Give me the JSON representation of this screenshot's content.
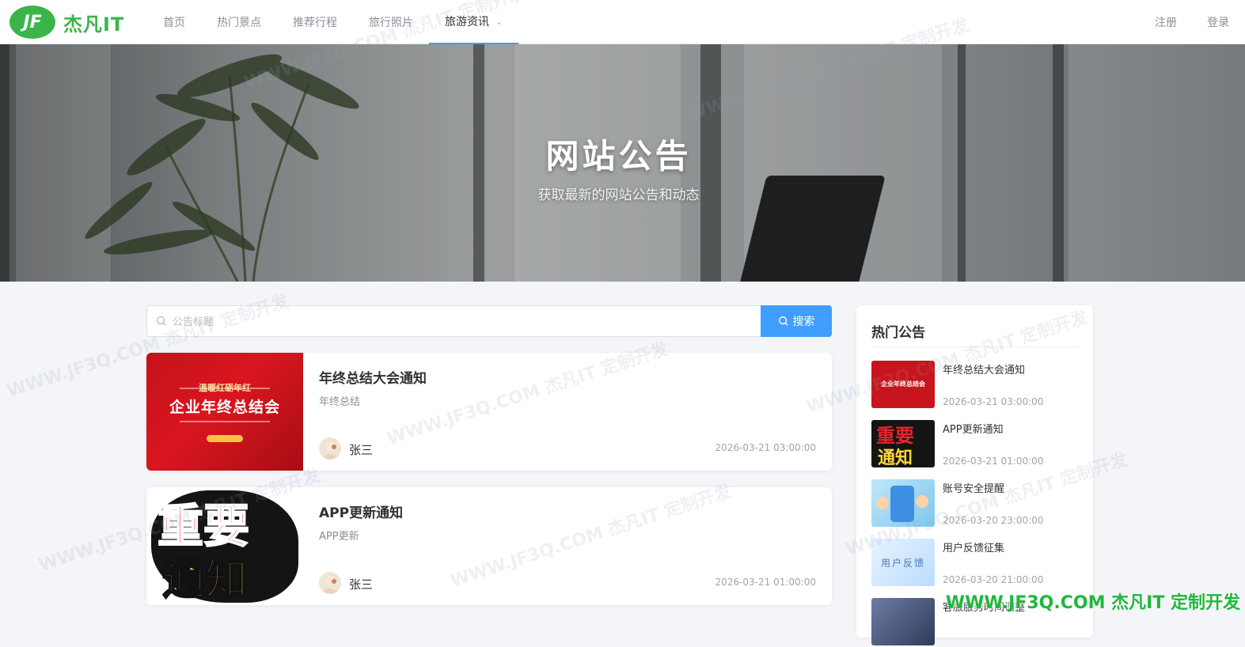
{
  "brand": {
    "logo_mark": "JF",
    "name": "杰凡IT"
  },
  "nav": {
    "items": [
      {
        "label": "首页"
      },
      {
        "label": "热门景点"
      },
      {
        "label": "推荐行程"
      },
      {
        "label": "旅行照片"
      },
      {
        "label": "旅游资讯"
      }
    ],
    "active_index": 4
  },
  "auth": {
    "register_label": "注册",
    "login_label": "登录"
  },
  "banner": {
    "title": "网站公告",
    "subtitle": "获取最新的网站公告和动态"
  },
  "search": {
    "placeholder": "公告标题",
    "value": "",
    "button_label": "搜索"
  },
  "notices": [
    {
      "title": "年终总结大会通知",
      "desc": "年终总结",
      "author": "张三",
      "time": "2026-03-21 03:00:00",
      "thumb": {
        "kind": "red-meeting",
        "line1": "溫暖红砺年红",
        "line2": "企业年终总结会"
      }
    },
    {
      "title": "APP更新通知",
      "desc": "APP更新",
      "author": "张三",
      "time": "2026-03-21 01:00:00",
      "thumb": {
        "kind": "important",
        "line1": "重要",
        "line2": "通知"
      }
    }
  ],
  "sidebar": {
    "title": "热门公告",
    "items": [
      {
        "title": "年终总结大会通知",
        "time": "2026-03-21 03:00:00",
        "thumb_text": "企业年终总结会"
      },
      {
        "title": "APP更新通知",
        "time": "2026-03-21 01:00:00",
        "thumb_text_a": "重要",
        "thumb_text_b": "通知"
      },
      {
        "title": "账号安全提醒",
        "time": "2026-03-20 23:00:00"
      },
      {
        "title": "用户反馈征集",
        "time": "2026-03-20 21:00:00",
        "thumb_text": "用户反馈"
      },
      {
        "title": "客服服务时间调整",
        "time": ""
      }
    ]
  },
  "watermark": {
    "text": "WWW.JF3Q.COM 杰凡IT 定制开发"
  },
  "colors": {
    "primary": "#409eff",
    "brand_green": "#3bb54a",
    "card_bg": "#ffffff",
    "page_bg": "#f3f5f9"
  }
}
